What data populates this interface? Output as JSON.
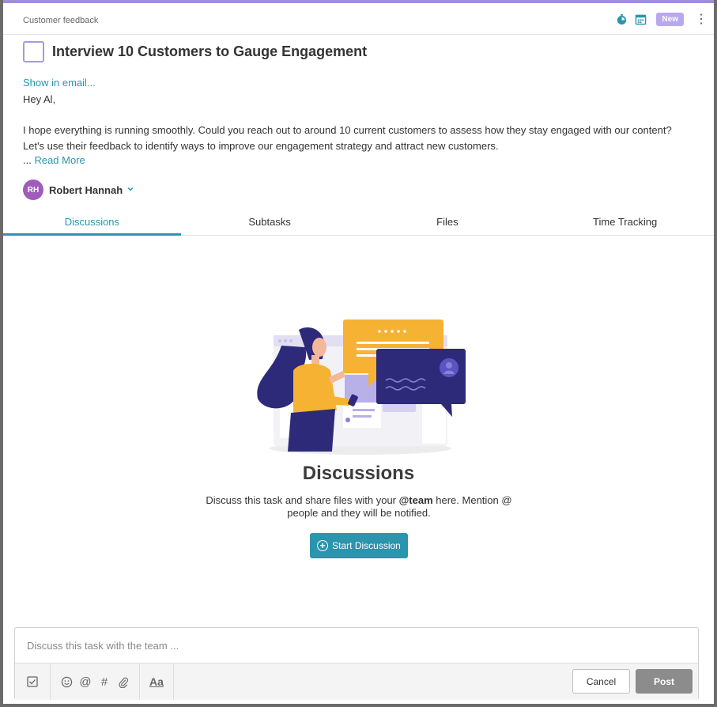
{
  "header": {
    "breadcrumb": "Customer feedback",
    "badge": "New",
    "icons": [
      "timer-icon",
      "calendar-icon",
      "more-vertical-icon"
    ]
  },
  "task": {
    "title": "Interview 10 Customers to Gauge Engagement",
    "show_in_email": "Show in email...",
    "greeting": "Hey Al,",
    "body": "I hope everything is running smoothly. Could you reach out to around 10 current customers to assess how they stay engaged with our content? Let's use their feedback to identify ways to improve our engagement strategy and attract new customers.",
    "ellipsis": "... ",
    "read_more": "Read More"
  },
  "assignee": {
    "initials": "RH",
    "name": "Robert Hannah"
  },
  "tabs": [
    {
      "label": "Discussions",
      "active": true
    },
    {
      "label": "Subtasks",
      "active": false
    },
    {
      "label": "Files",
      "active": false
    },
    {
      "label": "Time Tracking",
      "active": false
    }
  ],
  "empty_state": {
    "title": "Discussions",
    "desc_before": "Discuss this task and share files with your ",
    "desc_bold": "@team",
    "desc_after": " here. Mention @ people and they will be notified.",
    "button": "Start Discussion"
  },
  "composer": {
    "placeholder": "Discuss this task with the team ...",
    "cancel": "Cancel",
    "post": "Post",
    "format_label": "Aa"
  },
  "colors": {
    "accent": "#2a95ad",
    "badge": "#b8a9ef",
    "avatar": "#a05cbb",
    "top_border": "#9d8ddb"
  }
}
